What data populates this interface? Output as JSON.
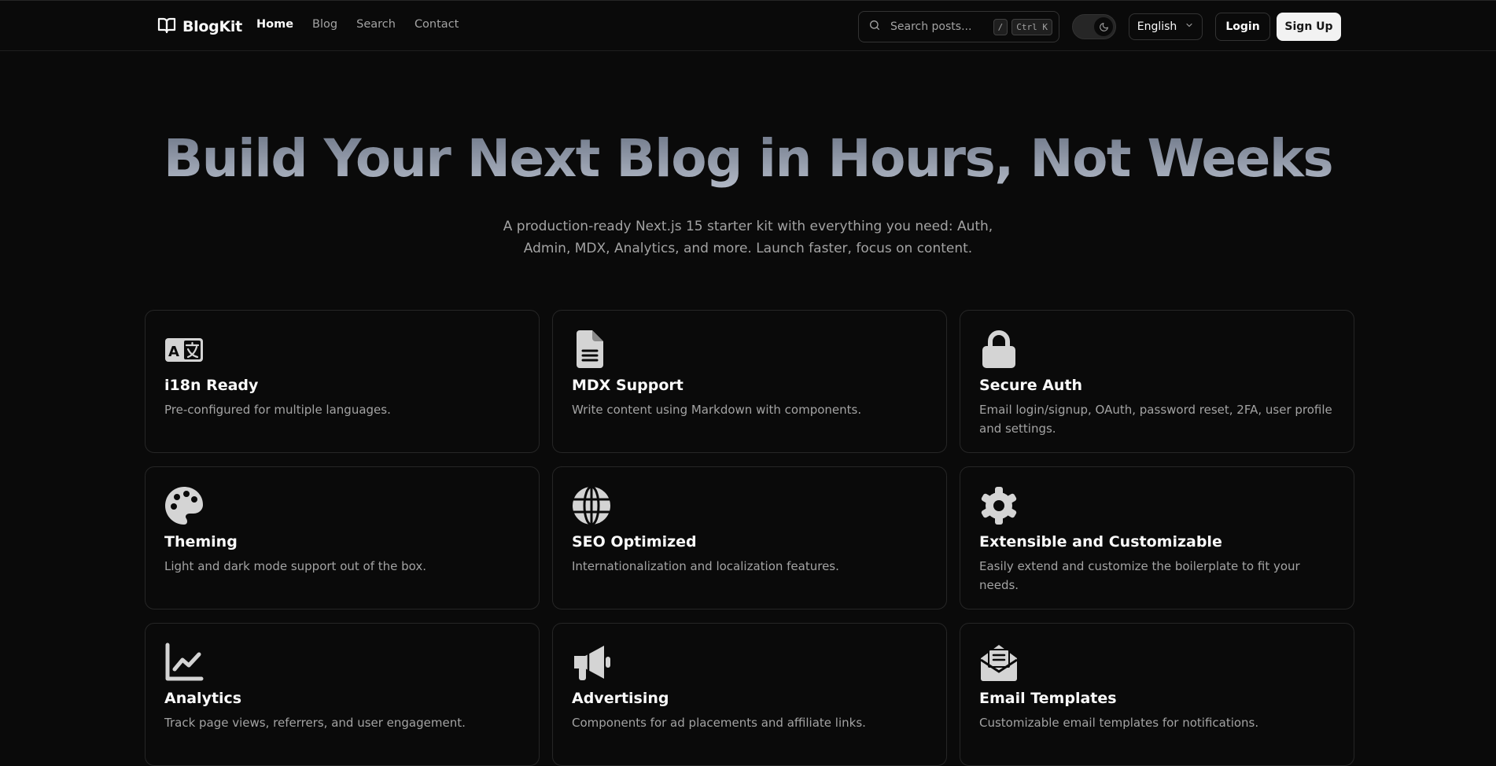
{
  "header": {
    "brand": "BlogKit",
    "nav": [
      {
        "label": "Home",
        "active": true
      },
      {
        "label": "Blog",
        "active": false
      },
      {
        "label": "Search",
        "active": false
      },
      {
        "label": "Contact",
        "active": false
      }
    ],
    "search": {
      "placeholder": "Search posts...",
      "shortcut_slash": "/",
      "shortcut_ctrl": "Ctrl K"
    },
    "theme_toggle": {
      "mode": "dark",
      "icon": "moon-icon"
    },
    "language": "English",
    "login_label": "Login",
    "signup_label": "Sign Up"
  },
  "hero": {
    "title": "Build Your Next Blog in Hours, Not Weeks",
    "subtitle": "A production-ready Next.js 15 starter kit with everything you need: Auth, Admin, MDX, Analytics, and more. Launch faster, focus on content."
  },
  "features": [
    {
      "icon": "language-icon",
      "title": "i18n Ready",
      "description": "Pre-configured for multiple languages."
    },
    {
      "icon": "file-text-icon",
      "title": "MDX Support",
      "description": "Write content using Markdown with components."
    },
    {
      "icon": "lock-icon",
      "title": "Secure Auth",
      "description": "Email login/signup, OAuth, password reset, 2FA, user profile and settings."
    },
    {
      "icon": "palette-icon",
      "title": "Theming",
      "description": "Light and dark mode support out of the box."
    },
    {
      "icon": "globe-icon",
      "title": "SEO Optimized",
      "description": "Internationalization and localization features."
    },
    {
      "icon": "gear-icon",
      "title": "Extensible and Customizable",
      "description": "Easily extend and customize the boilerplate to fit your needs."
    },
    {
      "icon": "chart-line-icon",
      "title": "Analytics",
      "description": "Track page views, referrers, and user engagement."
    },
    {
      "icon": "megaphone-icon",
      "title": "Advertising",
      "description": "Components for ad placements and affiliate links."
    },
    {
      "icon": "envelope-open-icon",
      "title": "Email Templates",
      "description": "Customizable email templates for notifications."
    }
  ],
  "colors": {
    "background": "#0a0a0a",
    "border": "#262626",
    "text_primary": "#fafafa",
    "text_muted": "#a3a3a3",
    "icon": "#d4d4d4"
  }
}
